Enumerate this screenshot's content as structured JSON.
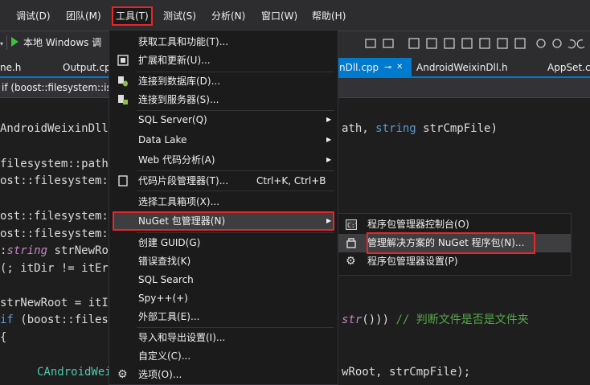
{
  "menubar": {
    "items": [
      {
        "label": "调试(D)"
      },
      {
        "label": "团队(M)"
      },
      {
        "label": "工具(T)"
      },
      {
        "label": "测试(S)"
      },
      {
        "label": "分析(N)"
      },
      {
        "label": "窗口(W)"
      },
      {
        "label": "帮助(H)"
      }
    ]
  },
  "toolbar": {
    "run_label": "本地 Windows 调"
  },
  "tabs": [
    {
      "label": "ne.h"
    },
    {
      "label": "Output.cp"
    },
    {
      "label": "nDll.cpp"
    },
    {
      "label": "AndroidWeixinDll.h"
    },
    {
      "label": "AppSet.cp"
    }
  ],
  "tab_pin_glyph": "⊸",
  "tab_close_glyph": "✕",
  "navbar": {
    "scope": "if (boost::filesystem::is_"
  },
  "code": {
    "line1a": "AndroidWeixinDll",
    "line1b": "ath, ",
    "line1c": "string",
    "line1d": " strCmpFile)",
    "line2": "filesystem::path",
    "line3": "ost::filesystem::",
    "line4": "ost::filesystem::",
    "line5": "ost::filesystem::",
    "line6a": ":",
    "line6b": "string",
    "line6c": " strNewRo",
    "line7a": "(; itDir != itEr",
    "line8": "strNewRoot = itI",
    "line9a": "if",
    "line9b": " (boost::files",
    "line9c": "str",
    "line9d": "())) ",
    "line9e": "// 判断文件是否是文件夹",
    "line10": "{",
    "line11a": "CAndroidWei",
    "line11b": "wRoot, strCmpFile);"
  },
  "tools_menu": {
    "items": [
      {
        "label": "获取工具和功能(T)..."
      },
      {
        "label": "扩展和更新(U)..."
      },
      {
        "label": "连接到数据库(D)..."
      },
      {
        "label": "连接到服务器(S)..."
      },
      {
        "label": "SQL Server(Q)"
      },
      {
        "label": "Data Lake"
      },
      {
        "label": "Web 代码分析(A)"
      },
      {
        "label": "代码片段管理器(T)...",
        "shortcut": "Ctrl+K, Ctrl+B"
      },
      {
        "label": "选择工具箱项(X)..."
      },
      {
        "label": "NuGet 包管理器(N)"
      },
      {
        "label": "创建 GUID(G)"
      },
      {
        "label": "错误查找(K)"
      },
      {
        "label": "SQL Search"
      },
      {
        "label": "Spy++(+)"
      },
      {
        "label": "外部工具(E)..."
      },
      {
        "label": "导入和导出设置(I)..."
      },
      {
        "label": "自定义(C)..."
      },
      {
        "label": "选项(O)..."
      }
    ]
  },
  "nuget_submenu": {
    "items": [
      {
        "label": "程序包管理器控制台(O)"
      },
      {
        "label": "管理解决方案的 NuGet 程序包(N)..."
      },
      {
        "label": "程序包管理器设置(P)"
      }
    ]
  },
  "icons": {
    "submenu_arrow": "▶",
    "gear": "⚙"
  }
}
